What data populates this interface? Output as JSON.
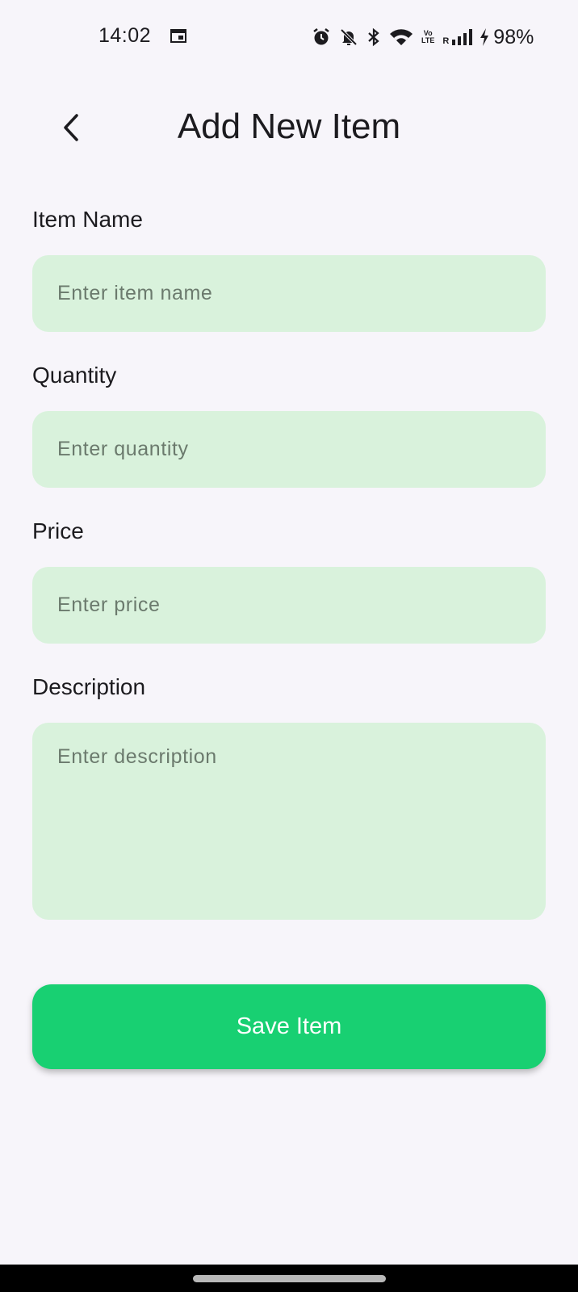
{
  "status_bar": {
    "time": "14:02",
    "battery": "98%",
    "icons": [
      "calendar-icon",
      "alarm-icon",
      "bell-off-icon",
      "bluetooth-icon",
      "wifi-icon",
      "volte-icon",
      "signal-icon",
      "charging-icon"
    ],
    "volte_top": "Vo",
    "volte_bottom": "LTE",
    "roaming": "R"
  },
  "header": {
    "title": "Add New Item",
    "back_icon": "chevron-left-icon"
  },
  "form": {
    "item_name": {
      "label": "Item Name",
      "placeholder": "Enter item name",
      "value": ""
    },
    "quantity": {
      "label": "Quantity",
      "placeholder": "Enter quantity",
      "value": ""
    },
    "price": {
      "label": "Price",
      "placeholder": "Enter price",
      "value": ""
    },
    "description": {
      "label": "Description",
      "placeholder": "Enter description",
      "value": ""
    },
    "save_label": "Save Item"
  },
  "colors": {
    "background": "#f7f5fa",
    "input_fill": "#d9f2dc",
    "primary": "#18d072",
    "text": "#1c1b1f",
    "placeholder": "#6b7a6d"
  }
}
